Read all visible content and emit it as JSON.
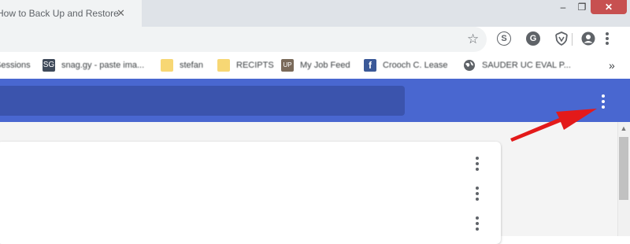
{
  "browser": {
    "tab_title": "How to Back Up and Restore",
    "tab_close_icon": "close-icon",
    "window_controls": {
      "minimize": "–",
      "maximize": "❐",
      "close": "✕"
    },
    "toolbar": {
      "bookmark_star": "☆",
      "extensions": [
        {
          "icon": "skype-icon",
          "glyph": "S"
        },
        {
          "icon": "grammarly-icon",
          "glyph": "G"
        },
        {
          "icon": "shield-extension-icon"
        }
      ],
      "menu_glyph": "⋮"
    },
    "bookmarks": [
      {
        "icon": "bookmark-page-icon",
        "label": "Sessions"
      },
      {
        "icon": "snag-icon",
        "glyph": "SG",
        "label": "snag.gy - paste ima..."
      },
      {
        "icon": "folder-icon",
        "label": "stefan"
      },
      {
        "icon": "folder-icon",
        "label": "RECIPTS"
      },
      {
        "icon": "upwork-icon",
        "glyph": "UP",
        "label": "My Job Feed"
      },
      {
        "icon": "facebook-icon",
        "glyph": "f",
        "label": "Crooch C. Lease"
      },
      {
        "icon": "globe-icon",
        "label": "SAUDER UC EVAL P..."
      }
    ],
    "bookmarks_more": "»"
  },
  "colors": {
    "app_bar": "#4967d0",
    "search_bar": "#3b54ad",
    "arrow": "#e31a1a",
    "menu_dots_app": "#ffffff",
    "menu_dots_rows": "#5f6368"
  },
  "app": {
    "menu_icon": "more-vert-icon",
    "rows": [
      {
        "menu_icon": "more-vert-icon"
      },
      {
        "menu_icon": "more-vert-icon"
      },
      {
        "menu_icon": "more-vert-icon"
      }
    ]
  },
  "annotation": {
    "icon": "red-arrow-icon"
  }
}
